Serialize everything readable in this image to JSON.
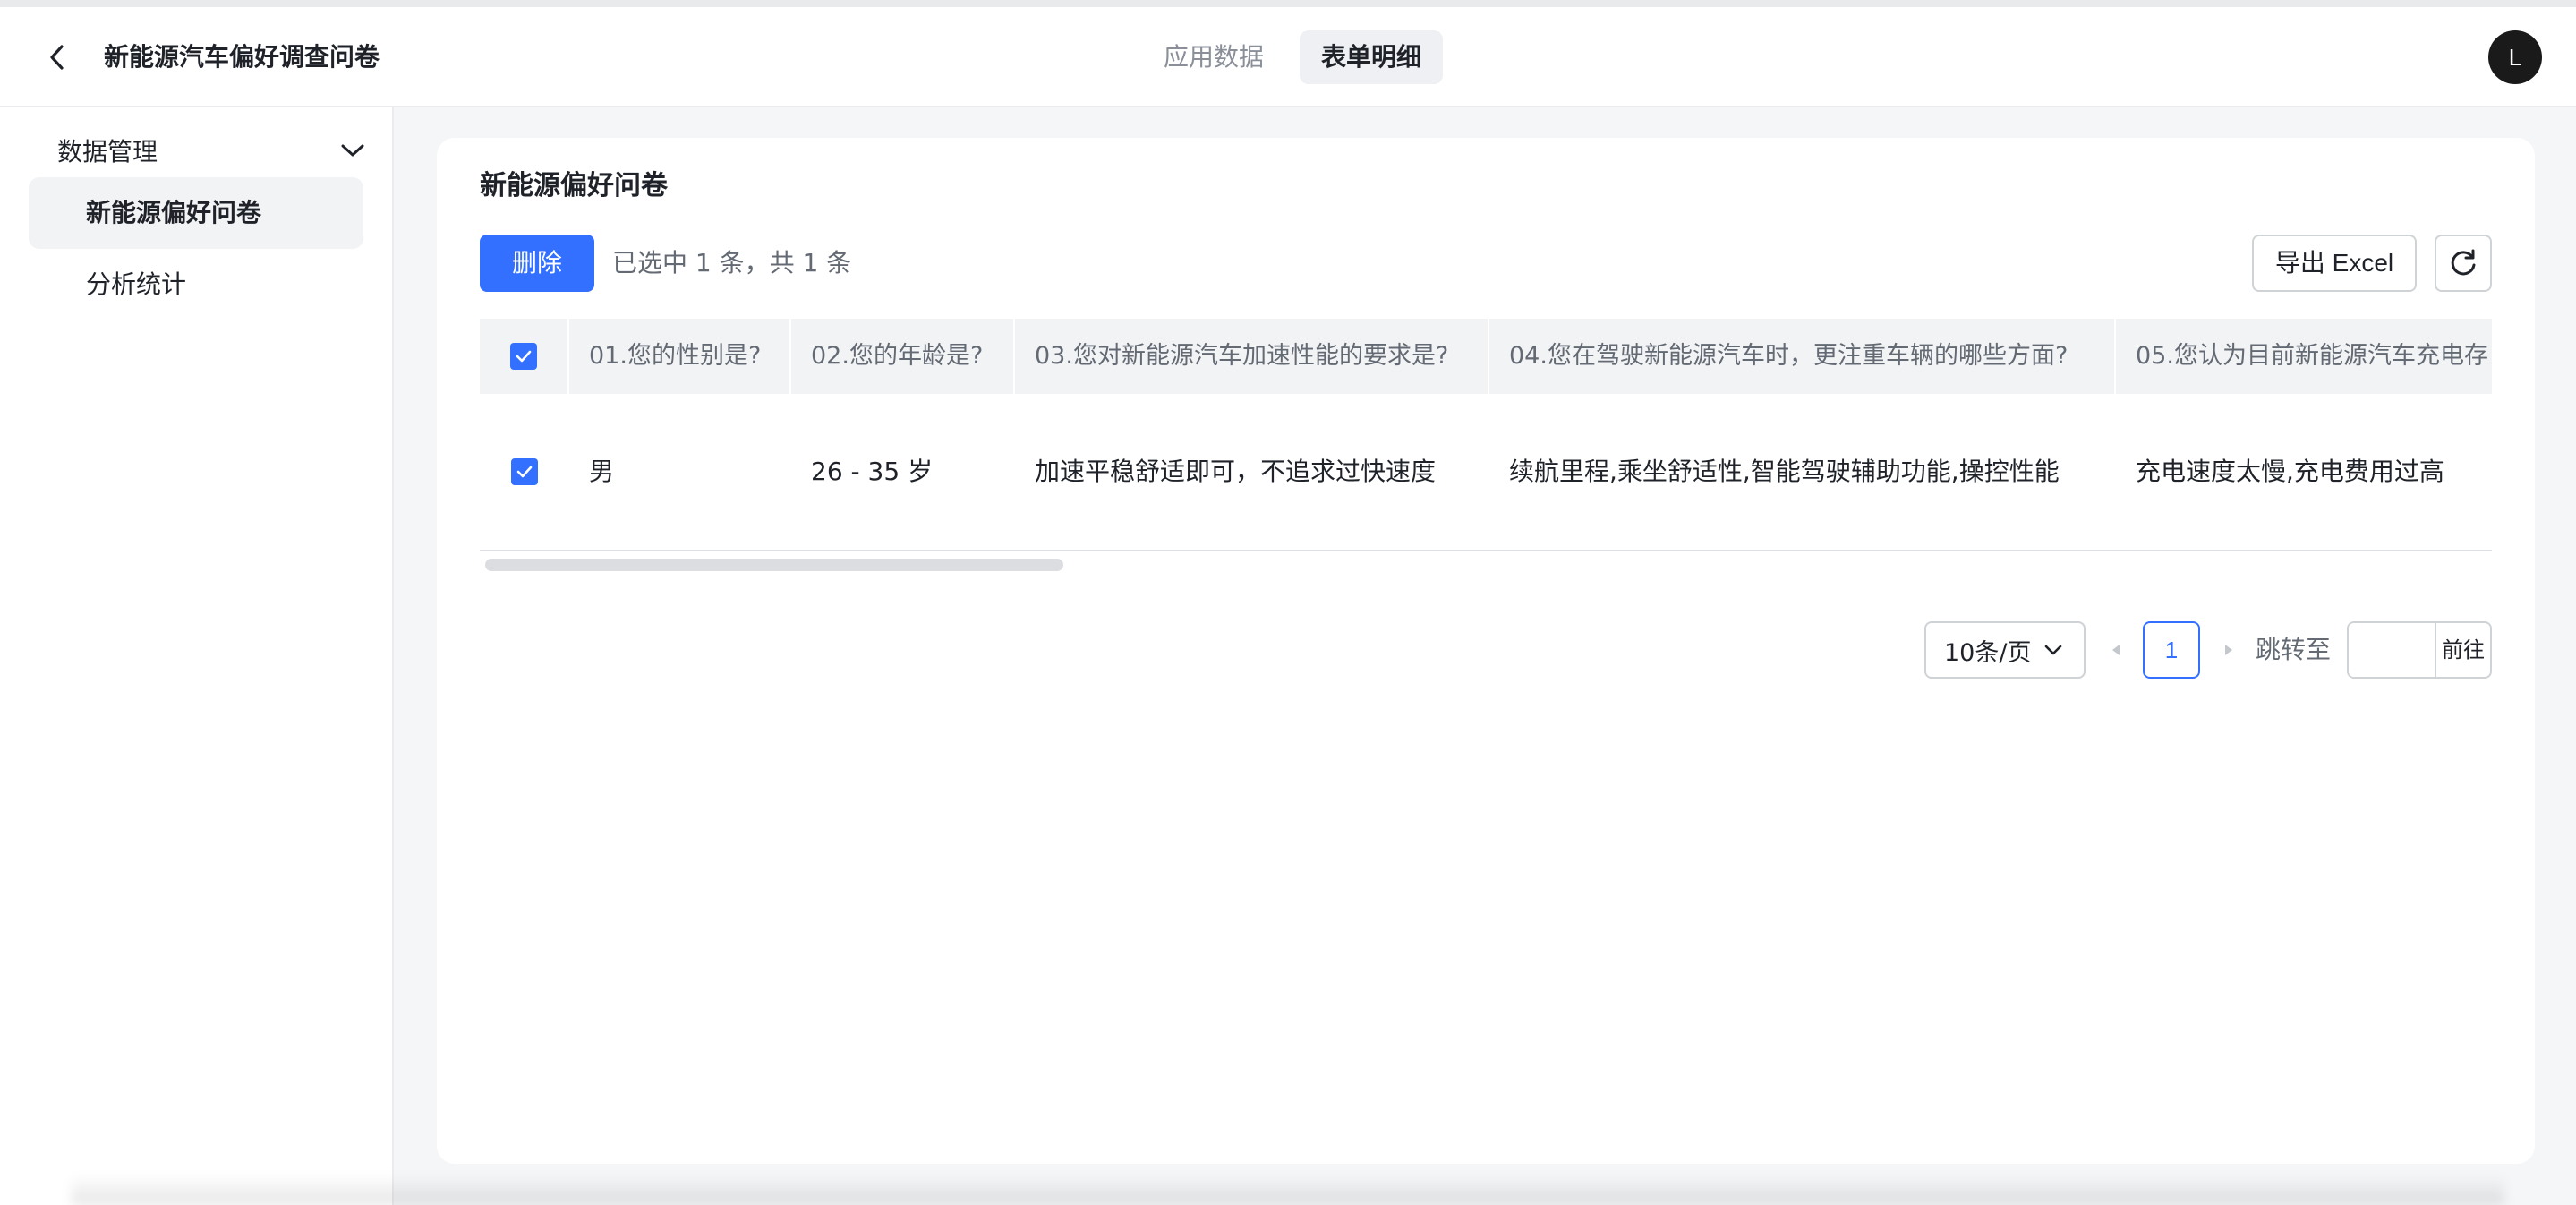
{
  "header": {
    "title": "新能源汽车偏好调查问卷",
    "tabs": [
      {
        "label": "应用数据",
        "active": false
      },
      {
        "label": "表单明细",
        "active": true
      }
    ],
    "avatar_initial": "L"
  },
  "sidebar": {
    "group_label": "数据管理",
    "items": [
      {
        "label": "新能源偏好问卷",
        "active": true
      },
      {
        "label": "分析统计",
        "active": false
      }
    ]
  },
  "main": {
    "title": "新能源偏好问卷",
    "delete_label": "删除",
    "selection_info": "已选中 1 条，共 1 条",
    "export_label": "导出 Excel",
    "table": {
      "columns": [
        "01.您的性别是?",
        "02.您的年龄是?",
        "03.您对新能源汽车加速性能的要求是?",
        "04.您在驾驶新能源汽车时，更注重车辆的哪些方面?",
        "05.您认为目前新能源汽车充电存"
      ],
      "rows": [
        {
          "checked": true,
          "cells": [
            "男",
            "26 - 35 岁",
            "加速平稳舒适即可，不追求过快速度",
            "续航里程,乘坐舒适性,智能驾驶辅助功能,操控性能",
            "充电速度太慢,充电费用过高"
          ]
        }
      ],
      "header_checked": true
    },
    "pagination": {
      "page_size": "10条/页",
      "current_page": "1",
      "jump_label": "跳转至",
      "jump_value": "",
      "go_label": "前往"
    }
  },
  "colors": {
    "accent": "#3370ff",
    "bg": "#f5f6f8",
    "text_primary": "#1f2329",
    "text_secondary": "#646a73"
  }
}
